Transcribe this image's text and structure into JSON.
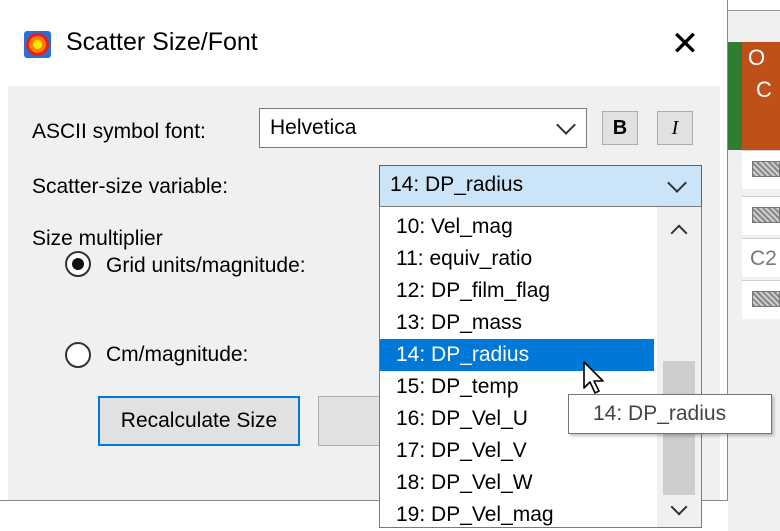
{
  "dialog": {
    "title": "Scatter Size/Font",
    "close_glyph": "✕",
    "app_icon": "app-logo-icon"
  },
  "font_row": {
    "label": "ASCII symbol font:",
    "value": "Helvetica",
    "bold_label": "B",
    "italic_label": "I"
  },
  "size_var": {
    "label": "Scatter-size variable:",
    "value": "14: DP_radius"
  },
  "multiplier": {
    "label": "Size multiplier",
    "options": [
      {
        "label": "Grid units/magnitude:",
        "checked": true
      },
      {
        "label": "Cm/magnitude:",
        "checked": false
      }
    ]
  },
  "buttons": {
    "recalculate": "Recalculate Size"
  },
  "dropdown": {
    "items": [
      "10: Vel_mag",
      "11: equiv_ratio",
      "12: DP_film_flag",
      "13: DP_mass",
      "14: DP_radius",
      "15: DP_temp",
      "16: DP_Vel_U",
      "17: DP_Vel_V",
      "18: DP_Vel_W",
      "19: DP_Vel_mag"
    ],
    "selected_index": 4
  },
  "tooltip": "14: DP_radius",
  "background_app": {
    "header_letters": [
      "O",
      "C"
    ],
    "cell_text": "C2"
  },
  "colors": {
    "accent": "#0078d7",
    "dialog_bg": "#f0f0f0"
  }
}
